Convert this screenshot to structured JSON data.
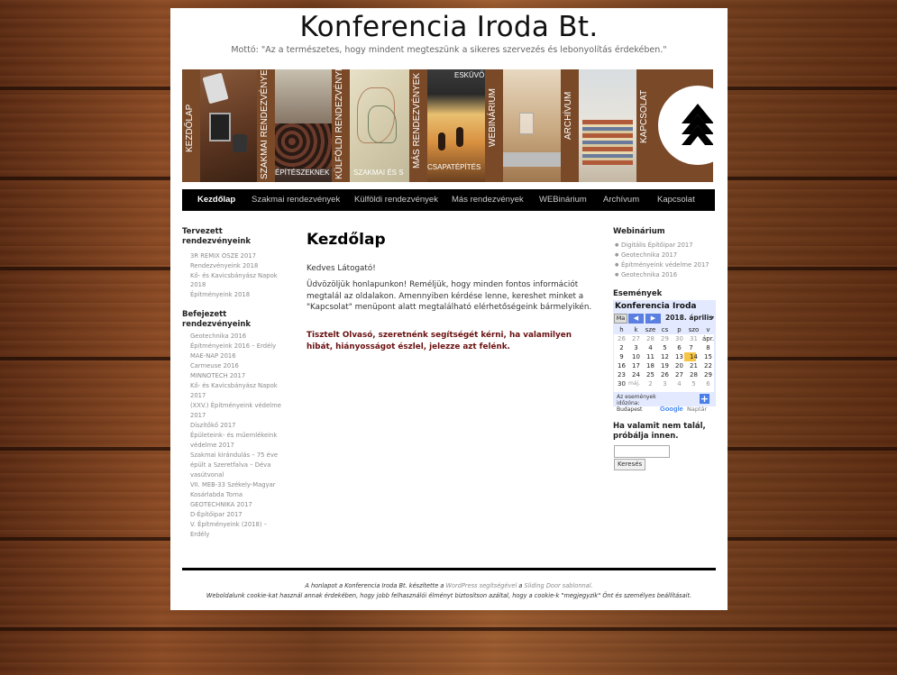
{
  "site": {
    "title": "Konferencia Iroda Bt.",
    "motto": "Mottó: \"Az a természetes, hogy mindent megteszünk a sikeres szervezés és lebonyolítás érdekében.\""
  },
  "banner": {
    "labels": [
      "KEZDŐLAP",
      "SZAKMAI RENDEZVÉNYEK",
      "KÜLFÖLDI RENDEZVÉNYEK",
      "MÁS RENDEZVÉNYEK",
      "WEBINÁRIUM",
      "ARCHÍVUM",
      "KAPCSOLAT"
    ],
    "overlays": [
      "ÉPÍTÉSZEKNEK",
      "SZAKMAI ÉS S",
      "ESKÜVŐ",
      "CSAPATÉPÍTÉS"
    ]
  },
  "nav": [
    "Kezdőlap",
    "Szakmai rendezvények",
    "Külföldi rendezvények",
    "Más rendezvények",
    "WEBinárium",
    "Archívum",
    "Kapcsolat"
  ],
  "left": {
    "planned_heading": "Tervezett rendezvényeink",
    "planned": [
      "3R REMIX OSZE 2017",
      "Rendezvényeink 2018",
      "Kő- és Kavicsbányász Napok",
      "2018",
      "Építményeink 2018"
    ],
    "finished_heading": "Befejezett rendezvényeink",
    "finished": [
      "Geotechnika 2016",
      "Építményeink 2016 – Erdély",
      "MAE-NAP 2016",
      "Carmeuse 2016",
      "MINNOTECH 2017",
      "Kő- és Kavicsbányász Napok",
      "2017",
      "(XXV.) Építményeink védelme",
      "2017",
      "Díszítőkő 2017",
      "Épületeink- és műemlékeink",
      "védelme 2017",
      "Szakmai kirándulás – 75 éve",
      "épült a Szeretfalva – Déva",
      "vasútvonal",
      "VII. MEB-33 Székely-Magyar",
      "Kosárlabda Torna",
      "GEOTECHNIKA 2017",
      "D-Építőipar 2017",
      "V. Építményeink (2018) –",
      "Erdély"
    ]
  },
  "content": {
    "title": "Kezdőlap",
    "greeting": "Kedves Látogató!",
    "p1": "Üdvözöljük honlapunkon! Reméljük, hogy minden fontos információt megtalál az oldalakon. Amennyiben kérdése lenne, kereshet minket a \"Kapcsolat\" menüpont alatt megtalálható elérhetőségeink bármelyikén.",
    "p2": "Tisztelt Olvasó, szeretnénk segítségét kérni, ha valamilyen hibát, hiányosságot észlel, jelezze azt felénk."
  },
  "right": {
    "webinar_heading": "Webinárium",
    "webinars": [
      "Digitális Építőipar 2017",
      "Geotechnika 2017",
      "Építményeink védelme 2017",
      "Geotechnika 2016"
    ],
    "events_heading": "Események",
    "calendar": {
      "title": "Konferencia Iroda",
      "today_btn": "Ma",
      "month": "2018. április",
      "weekdays": [
        "h",
        "k",
        "sze",
        "cs",
        "p",
        "szo",
        "v"
      ],
      "weeks": [
        [
          "26",
          "27",
          "28",
          "29",
          "30",
          "31",
          "ápr."
        ],
        [
          "2",
          "3",
          "4",
          "5",
          "6",
          "7",
          "8"
        ],
        [
          "9",
          "10",
          "11",
          "12",
          "13",
          "14",
          "15"
        ],
        [
          "16",
          "17",
          "18",
          "19",
          "20",
          "21",
          "22"
        ],
        [
          "23",
          "24",
          "25",
          "26",
          "27",
          "28",
          "29"
        ],
        [
          "30",
          "máj.",
          "2",
          "3",
          "4",
          "5",
          "6"
        ]
      ],
      "tz_line1": "Az események",
      "tz_line2": "időzóna:",
      "tz_line3": "Budapest",
      "google": "Google",
      "naptar": "Naptár"
    },
    "search_heading": "Ha valamit nem talál, próbálja innen.",
    "search_button": "Keresés",
    "search_value": ""
  },
  "footer": {
    "l1_a": "A honlapot a Konferencia Iroda Bt. készítette a ",
    "l1_b": "WordPress segítségével",
    "l1_c": " a ",
    "l1_d": "Sliding Door sablonnal.",
    "l2": "Weboldalunk cookie-kat használ annak érdekében, hogy jobb felhasználói élményt biztosítson azáltal, hogy a cookie-k \"megjegyzik\" Önt és személyes beállításait."
  },
  "colors": {
    "nav_bg": "#000000",
    "strong_text": "#6a1010",
    "today": "#f7c546",
    "calendar_bg": "#e3e9ff"
  }
}
